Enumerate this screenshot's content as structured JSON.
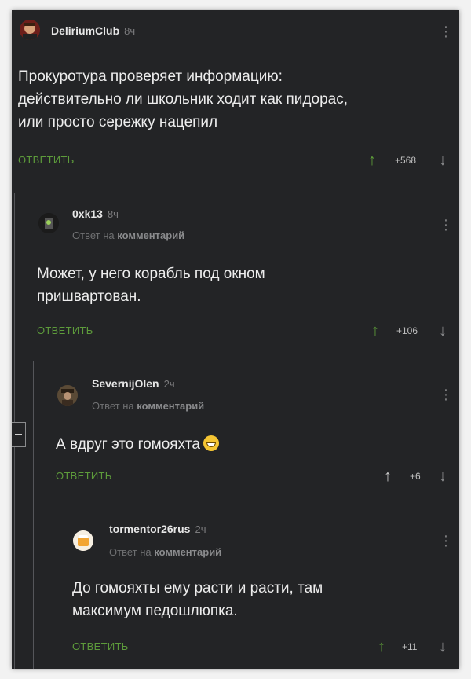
{
  "comments": [
    {
      "username": "DeliriumClub",
      "time": "8ч",
      "reply_to": null,
      "text": "Прокуротура проверяет информацию:\nдействительно ли школьник ходит как пидорас,\nили просто сережку нацепил",
      "reply_label": "ОТВЕТИТЬ",
      "rating": "+568"
    },
    {
      "username": "0xk13",
      "time": "8ч",
      "reply_to_prefix": "Ответ на",
      "reply_to_target": "комментарий",
      "text": "Может, у него корабль под окном\nпришвартован.",
      "reply_label": "ОТВЕТИТЬ",
      "rating": "+106"
    },
    {
      "username": "SevernijOlen",
      "time": "2ч",
      "reply_to_prefix": "Ответ на",
      "reply_to_target": "комментарий",
      "text": "А вдруг это гомояхта",
      "reply_label": "ОТВЕТИТЬ",
      "rating": "+6"
    },
    {
      "username": "tormentor26rus",
      "time": "2ч",
      "reply_to_prefix": "Ответ на",
      "reply_to_target": "комментарий",
      "text": "До гомояхты ему расти и расти, там\nмаксимум педошлюпка.",
      "reply_label": "ОТВЕТИТЬ",
      "rating": "+11"
    }
  ],
  "icons": {
    "vote_up": "arrow-up-icon",
    "vote_down": "arrow-down-icon",
    "menu": "more-vertical-icon",
    "emoji": "grinning-face-icon"
  },
  "colors": {
    "background": "#232426",
    "accent_green": "#5d9b3b",
    "text": "#ededed",
    "muted": "#7b7b7d"
  }
}
